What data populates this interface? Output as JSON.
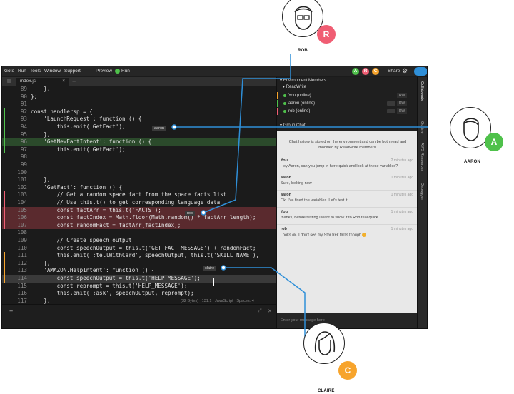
{
  "menu": [
    "Goto",
    "Run",
    "Tools",
    "Window",
    "Support"
  ],
  "preview_label": "Preview",
  "run_label": "Run",
  "share_label": "Share",
  "collaborator_initials": [
    "A",
    "R",
    "C"
  ],
  "tab": {
    "name": "index.js",
    "close": "×",
    "add": "+"
  },
  "code_lines": [
    {
      "n": "89",
      "t": "    },",
      "hl": ""
    },
    {
      "n": "90",
      "t": "};",
      "hl": ""
    },
    {
      "n": "91",
      "t": "",
      "hl": ""
    },
    {
      "n": "92",
      "t": "const handlersp = {",
      "hl": ""
    },
    {
      "n": "93",
      "t": "    'LaunchRequest': function () {",
      "hl": ""
    },
    {
      "n": "94",
      "t": "        this.emit('GetFact');",
      "hl": ""
    },
    {
      "n": "95",
      "t": "    },",
      "hl": ""
    },
    {
      "n": "96",
      "t": "    'GetNewFactIntent': function () {",
      "hl": "green"
    },
    {
      "n": "97",
      "t": "        this.emit('GetFact');",
      "hl": ""
    },
    {
      "n": "98",
      "t": "",
      "hl": ""
    },
    {
      "n": "99",
      "t": "",
      "hl": ""
    },
    {
      "n": "100",
      "t": "",
      "hl": ""
    },
    {
      "n": "101",
      "t": "    },",
      "hl": ""
    },
    {
      "n": "102",
      "t": "    'GetFact': function () {",
      "hl": ""
    },
    {
      "n": "103",
      "t": "        // Get a random space fact from the space facts list",
      "hl": ""
    },
    {
      "n": "104",
      "t": "        // Use this.t() to get corresponding language data",
      "hl": ""
    },
    {
      "n": "105",
      "t": "        const factArr = this.t('FACTS');",
      "hl": "red"
    },
    {
      "n": "106",
      "t": "        const factIndex = Math.floor(Math.random() * factArr.length);",
      "hl": "red"
    },
    {
      "n": "107",
      "t": "        const randomFact = factArr[factIndex];",
      "hl": "red"
    },
    {
      "n": "108",
      "t": "",
      "hl": ""
    },
    {
      "n": "109",
      "t": "        // Create speech output",
      "hl": ""
    },
    {
      "n": "110",
      "t": "        const speechOutput = this.t('GET_FACT_MESSAGE') + randomFact;",
      "hl": ""
    },
    {
      "n": "111",
      "t": "        this.emit(':tellWithCard', speechOutput, this.t('SKILL_NAME'),",
      "hl": ""
    },
    {
      "n": "112",
      "t": "    },",
      "hl": ""
    },
    {
      "n": "113",
      "t": "    'AMAZON.HelpIntent': function () {",
      "hl": ""
    },
    {
      "n": "114",
      "t": "        const speechOutput = this.t('HELP_MESSAGE');",
      "hl": "sel"
    },
    {
      "n": "115",
      "t": "        const reprompt = this.t('HELP_MESSAGE');",
      "hl": ""
    },
    {
      "n": "116",
      "t": "        this.emit(':ask', speechOutput, reprompt);",
      "hl": ""
    },
    {
      "n": "117",
      "t": "    },",
      "hl": ""
    }
  ],
  "cursor_labels": {
    "aaron": "aaron",
    "rob": "rob",
    "claire": "claire"
  },
  "status": {
    "size": "(32 Bytes)",
    "position": "131:1",
    "language": "JavaScript",
    "spaces": "Spaces: 4"
  },
  "panel": {
    "env_members_title": "Environment Members",
    "readwrite_title": "ReadWrite",
    "members": [
      {
        "name": "You (online)",
        "perm": "RW"
      },
      {
        "name": "aaron (online)",
        "perm": "RW"
      },
      {
        "name": "rob (online)",
        "perm": "RW"
      }
    ],
    "group_chat_title": "Group Chat",
    "chat_info": "Chat history is stored on the environment and can be both read and modified by ReadWrite members.",
    "messages": [
      {
        "who": "You",
        "time": "2 minutes ago",
        "text": "Hey Aaron, can you jump in here quick and look at these variables?"
      },
      {
        "who": "aaron",
        "time": "1 minutes ago",
        "text": "Sure, looking now"
      },
      {
        "who": "aaron",
        "time": "1 minutes ago",
        "text": "Ok, I've fixed the variables. Let's test it"
      },
      {
        "who": "You",
        "time": "1 minutes ago",
        "text": "thanks, before testing I want to show it to Rob real quick"
      },
      {
        "who": "rob",
        "time": "1 minutes ago",
        "text": "Looks ok. I don't see my Star trek facts though"
      }
    ],
    "input_placeholder": "Enter your message here"
  },
  "right_tabs": [
    "Collaborate",
    "Outline",
    "AWS Resources",
    "Debugger"
  ],
  "personas": [
    {
      "name": "ROB",
      "initial": "R",
      "color": "#f05d73"
    },
    {
      "name": "AARON",
      "initial": "A",
      "color": "#4fc14b"
    },
    {
      "name": "CLAIRE",
      "initial": "C",
      "color": "#f7a42c"
    }
  ],
  "colors": {
    "accent": "#2f8fd8",
    "green": "#4fc14b",
    "red": "#f05d73",
    "orange": "#f7a42c"
  }
}
